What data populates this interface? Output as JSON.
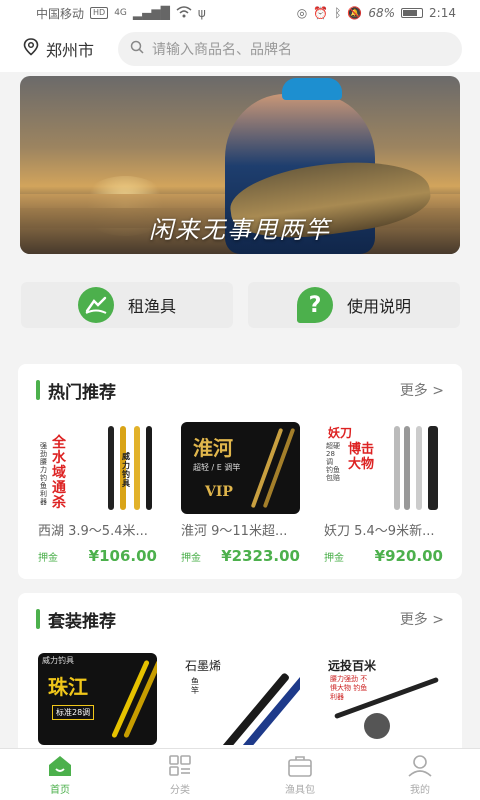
{
  "status": {
    "carrier": "中国移动",
    "network_badge": "HD",
    "signal_label": "4G",
    "battery": "68%",
    "time": "2:14"
  },
  "header": {
    "city": "郑州市",
    "search_placeholder": "请输入商品名、品牌名"
  },
  "banner": {
    "slogan": "闲来无事甩两竿"
  },
  "quick_actions": [
    {
      "label": "租渔具",
      "icon": "fishing-icon"
    },
    {
      "label": "使用说明",
      "icon": "help-icon"
    }
  ],
  "hot": {
    "title": "热门推荐",
    "more": "更多 >",
    "thumb_texts": {
      "p0_main": "全水域通杀",
      "p0_side": "强劲腰力 钓鱼利器",
      "p0_brand": "威力钓具",
      "p1_main": "淮河",
      "p1_sub": "超轻 / E 调竿",
      "p1_badge": "VIP",
      "p2_brand": "妖刀",
      "p2_main": "博击大物",
      "p2_side": "超硬 28调 钓鱼包赔"
    },
    "products": [
      {
        "name": "西湖 3.9～5.4米...",
        "deposit_label": "押金",
        "price": "¥106.00"
      },
      {
        "name": "淮河 9～11米超...",
        "deposit_label": "押金",
        "price": "¥2323.00"
      },
      {
        "name": "妖刀 5.4～9米新...",
        "deposit_label": "押金",
        "price": "¥920.00"
      }
    ]
  },
  "pack": {
    "title": "套装推荐",
    "more": "更多 >",
    "thumb_texts": {
      "p0_brand": "威力钓具",
      "p0_main": "珠江",
      "p0_sub": "标准28调",
      "p1_main": "石墨烯",
      "p1_sub": "鱼竿",
      "p2_main": "远投百米",
      "p2_side": "腰力强劲 不惧大物 钓鱼利器"
    }
  },
  "nav": [
    {
      "label": "首页",
      "icon": "home-icon",
      "active": true
    },
    {
      "label": "分类",
      "icon": "category-icon",
      "active": false
    },
    {
      "label": "渔具包",
      "icon": "bag-icon",
      "active": false
    },
    {
      "label": "我的",
      "icon": "profile-icon",
      "active": false
    }
  ],
  "colors": {
    "accent": "#4cb04c",
    "price": "#4cb04c",
    "nav_inactive": "#aaaaaa"
  }
}
